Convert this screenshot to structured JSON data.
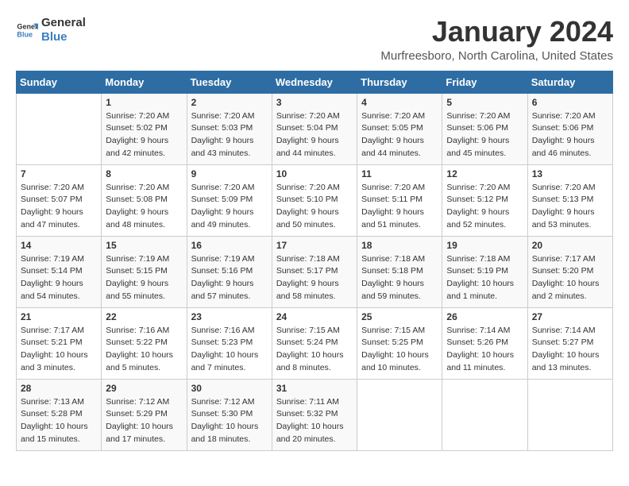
{
  "logo": {
    "line1": "General",
    "line2": "Blue"
  },
  "title": "January 2024",
  "location": "Murfreesboro, North Carolina, United States",
  "headers": [
    "Sunday",
    "Monday",
    "Tuesday",
    "Wednesday",
    "Thursday",
    "Friday",
    "Saturday"
  ],
  "weeks": [
    [
      {
        "day": "",
        "sunrise": "",
        "sunset": "",
        "daylight": ""
      },
      {
        "day": "1",
        "sunrise": "Sunrise: 7:20 AM",
        "sunset": "Sunset: 5:02 PM",
        "daylight": "Daylight: 9 hours and 42 minutes."
      },
      {
        "day": "2",
        "sunrise": "Sunrise: 7:20 AM",
        "sunset": "Sunset: 5:03 PM",
        "daylight": "Daylight: 9 hours and 43 minutes."
      },
      {
        "day": "3",
        "sunrise": "Sunrise: 7:20 AM",
        "sunset": "Sunset: 5:04 PM",
        "daylight": "Daylight: 9 hours and 44 minutes."
      },
      {
        "day": "4",
        "sunrise": "Sunrise: 7:20 AM",
        "sunset": "Sunset: 5:05 PM",
        "daylight": "Daylight: 9 hours and 44 minutes."
      },
      {
        "day": "5",
        "sunrise": "Sunrise: 7:20 AM",
        "sunset": "Sunset: 5:06 PM",
        "daylight": "Daylight: 9 hours and 45 minutes."
      },
      {
        "day": "6",
        "sunrise": "Sunrise: 7:20 AM",
        "sunset": "Sunset: 5:06 PM",
        "daylight": "Daylight: 9 hours and 46 minutes."
      }
    ],
    [
      {
        "day": "7",
        "sunrise": "Sunrise: 7:20 AM",
        "sunset": "Sunset: 5:07 PM",
        "daylight": "Daylight: 9 hours and 47 minutes."
      },
      {
        "day": "8",
        "sunrise": "Sunrise: 7:20 AM",
        "sunset": "Sunset: 5:08 PM",
        "daylight": "Daylight: 9 hours and 48 minutes."
      },
      {
        "day": "9",
        "sunrise": "Sunrise: 7:20 AM",
        "sunset": "Sunset: 5:09 PM",
        "daylight": "Daylight: 9 hours and 49 minutes."
      },
      {
        "day": "10",
        "sunrise": "Sunrise: 7:20 AM",
        "sunset": "Sunset: 5:10 PM",
        "daylight": "Daylight: 9 hours and 50 minutes."
      },
      {
        "day": "11",
        "sunrise": "Sunrise: 7:20 AM",
        "sunset": "Sunset: 5:11 PM",
        "daylight": "Daylight: 9 hours and 51 minutes."
      },
      {
        "day": "12",
        "sunrise": "Sunrise: 7:20 AM",
        "sunset": "Sunset: 5:12 PM",
        "daylight": "Daylight: 9 hours and 52 minutes."
      },
      {
        "day": "13",
        "sunrise": "Sunrise: 7:20 AM",
        "sunset": "Sunset: 5:13 PM",
        "daylight": "Daylight: 9 hours and 53 minutes."
      }
    ],
    [
      {
        "day": "14",
        "sunrise": "Sunrise: 7:19 AM",
        "sunset": "Sunset: 5:14 PM",
        "daylight": "Daylight: 9 hours and 54 minutes."
      },
      {
        "day": "15",
        "sunrise": "Sunrise: 7:19 AM",
        "sunset": "Sunset: 5:15 PM",
        "daylight": "Daylight: 9 hours and 55 minutes."
      },
      {
        "day": "16",
        "sunrise": "Sunrise: 7:19 AM",
        "sunset": "Sunset: 5:16 PM",
        "daylight": "Daylight: 9 hours and 57 minutes."
      },
      {
        "day": "17",
        "sunrise": "Sunrise: 7:18 AM",
        "sunset": "Sunset: 5:17 PM",
        "daylight": "Daylight: 9 hours and 58 minutes."
      },
      {
        "day": "18",
        "sunrise": "Sunrise: 7:18 AM",
        "sunset": "Sunset: 5:18 PM",
        "daylight": "Daylight: 9 hours and 59 minutes."
      },
      {
        "day": "19",
        "sunrise": "Sunrise: 7:18 AM",
        "sunset": "Sunset: 5:19 PM",
        "daylight": "Daylight: 10 hours and 1 minute."
      },
      {
        "day": "20",
        "sunrise": "Sunrise: 7:17 AM",
        "sunset": "Sunset: 5:20 PM",
        "daylight": "Daylight: 10 hours and 2 minutes."
      }
    ],
    [
      {
        "day": "21",
        "sunrise": "Sunrise: 7:17 AM",
        "sunset": "Sunset: 5:21 PM",
        "daylight": "Daylight: 10 hours and 3 minutes."
      },
      {
        "day": "22",
        "sunrise": "Sunrise: 7:16 AM",
        "sunset": "Sunset: 5:22 PM",
        "daylight": "Daylight: 10 hours and 5 minutes."
      },
      {
        "day": "23",
        "sunrise": "Sunrise: 7:16 AM",
        "sunset": "Sunset: 5:23 PM",
        "daylight": "Daylight: 10 hours and 7 minutes."
      },
      {
        "day": "24",
        "sunrise": "Sunrise: 7:15 AM",
        "sunset": "Sunset: 5:24 PM",
        "daylight": "Daylight: 10 hours and 8 minutes."
      },
      {
        "day": "25",
        "sunrise": "Sunrise: 7:15 AM",
        "sunset": "Sunset: 5:25 PM",
        "daylight": "Daylight: 10 hours and 10 minutes."
      },
      {
        "day": "26",
        "sunrise": "Sunrise: 7:14 AM",
        "sunset": "Sunset: 5:26 PM",
        "daylight": "Daylight: 10 hours and 11 minutes."
      },
      {
        "day": "27",
        "sunrise": "Sunrise: 7:14 AM",
        "sunset": "Sunset: 5:27 PM",
        "daylight": "Daylight: 10 hours and 13 minutes."
      }
    ],
    [
      {
        "day": "28",
        "sunrise": "Sunrise: 7:13 AM",
        "sunset": "Sunset: 5:28 PM",
        "daylight": "Daylight: 10 hours and 15 minutes."
      },
      {
        "day": "29",
        "sunrise": "Sunrise: 7:12 AM",
        "sunset": "Sunset: 5:29 PM",
        "daylight": "Daylight: 10 hours and 17 minutes."
      },
      {
        "day": "30",
        "sunrise": "Sunrise: 7:12 AM",
        "sunset": "Sunset: 5:30 PM",
        "daylight": "Daylight: 10 hours and 18 minutes."
      },
      {
        "day": "31",
        "sunrise": "Sunrise: 7:11 AM",
        "sunset": "Sunset: 5:32 PM",
        "daylight": "Daylight: 10 hours and 20 minutes."
      },
      {
        "day": "",
        "sunrise": "",
        "sunset": "",
        "daylight": ""
      },
      {
        "day": "",
        "sunrise": "",
        "sunset": "",
        "daylight": ""
      },
      {
        "day": "",
        "sunrise": "",
        "sunset": "",
        "daylight": ""
      }
    ]
  ]
}
